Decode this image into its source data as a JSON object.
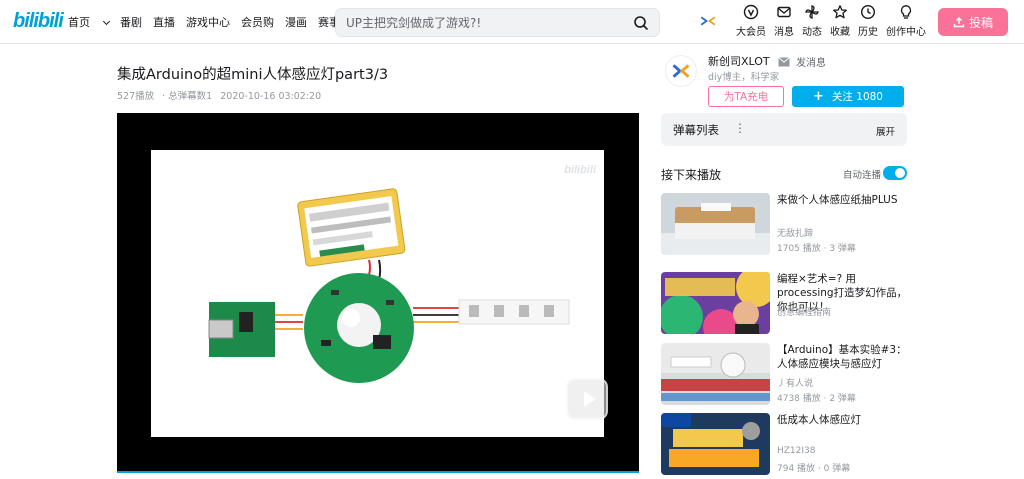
{
  "header": {
    "logo": "bilibili",
    "nav": [
      "首页",
      "番剧",
      "直播",
      "游戏中心",
      "会员购",
      "漫画",
      "赛事"
    ],
    "search_placeholder": "UP主把究剑做成了游戏?!",
    "right": [
      "大会员",
      "消息",
      "动态",
      "收藏",
      "历史",
      "创作中心"
    ],
    "upload_label": "投稿"
  },
  "video": {
    "title": "集成Arduino的超mini人体感应灯part3/3",
    "plays": "527播放",
    "danmaku": "· 总弹幕数1",
    "date": "2020-10-16 03:02:20",
    "watermark": "bilibili"
  },
  "uploader": {
    "name": "新创司XLOT",
    "message_label": "发消息",
    "desc": "diy博主，科学家",
    "charge_label": "为TA充电",
    "follow_label": "关注 1080",
    "follow_plus": "+"
  },
  "danmaku_panel": {
    "title": "弹幕列表",
    "dots": "⋮",
    "expand": "展开"
  },
  "next": {
    "title": "接下来播放",
    "autoplay_label": "自动连播"
  },
  "recommendations": [
    {
      "title": "来做个人体感应纸抽PLUS",
      "up": "无敌扎蹄",
      "stats": "1705 播放 · 3 弹幕"
    },
    {
      "title": "编程×艺术=? 用processing打造梦幻作品，你也可以！",
      "up": "创意编程指南",
      "stats": ""
    },
    {
      "title": "【Arduino】基本实验#3：人体感应模块与感应灯",
      "up": "丿有人说",
      "stats": "4738 播放 · 2 弹幕"
    },
    {
      "title": "低成本人体感应灯",
      "up": "HZ12I38",
      "stats": "794 播放 · 0 弹幕"
    }
  ],
  "colors": {
    "brand_blue": "#00a1d6",
    "follow_blue": "#00aeec",
    "pink": "#fb7299"
  }
}
